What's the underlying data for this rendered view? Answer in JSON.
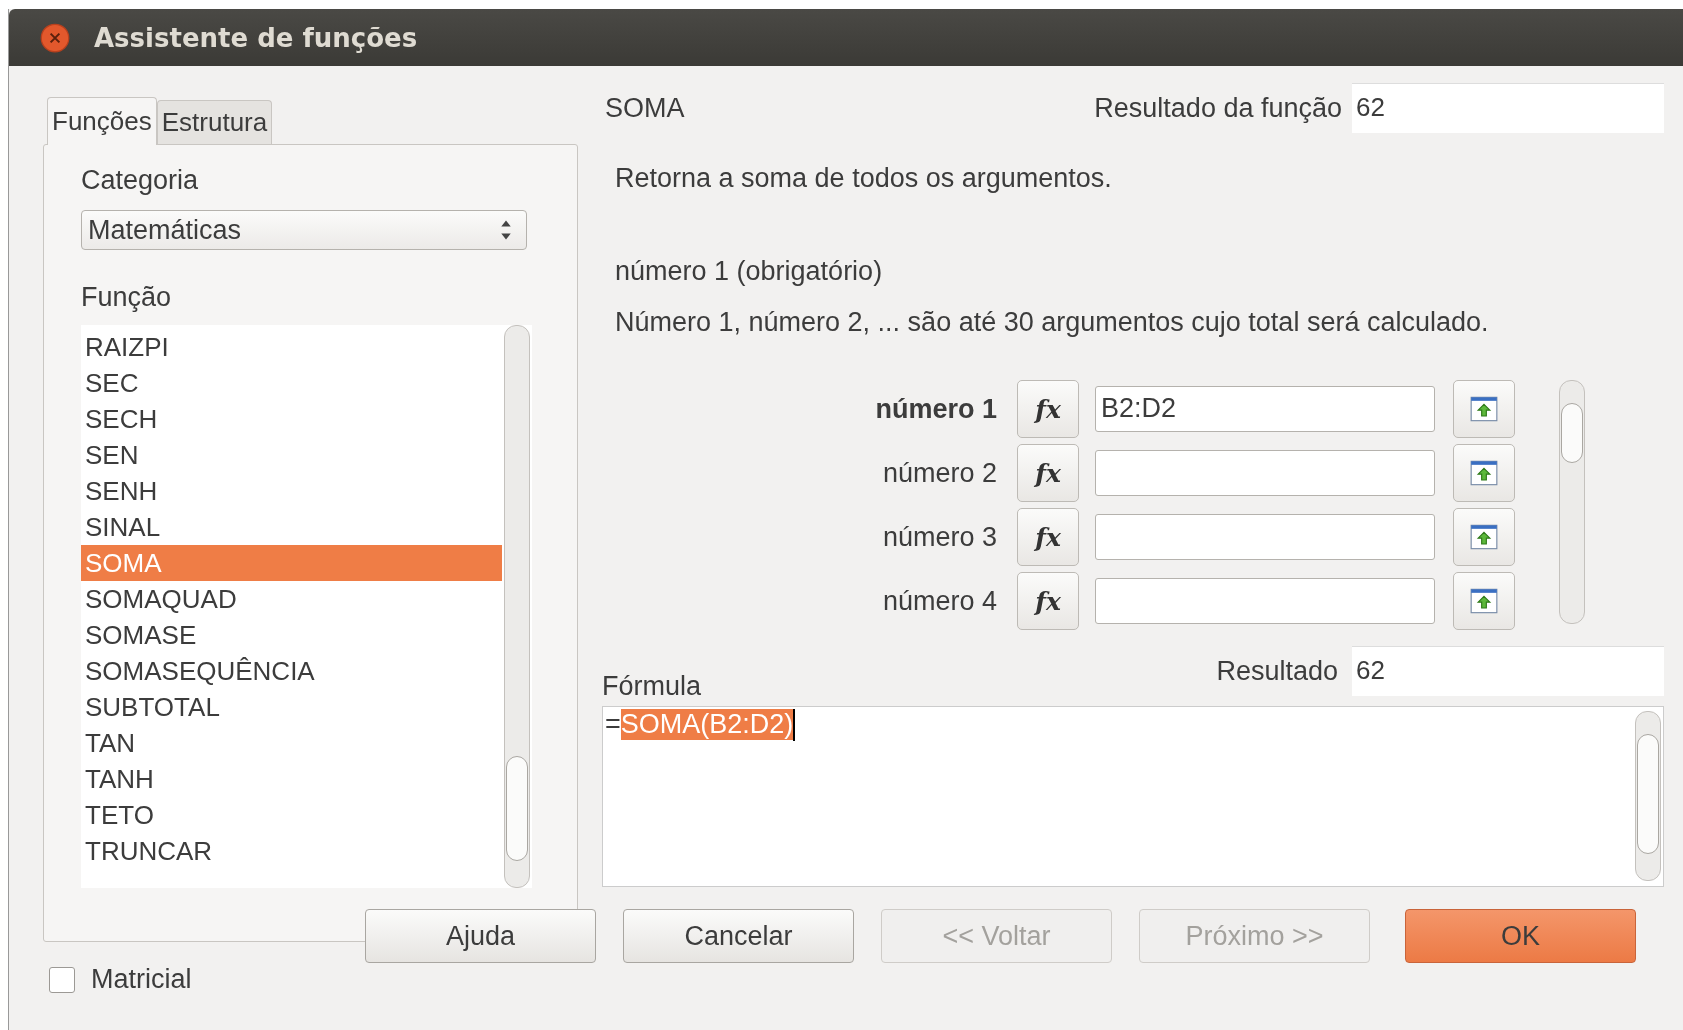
{
  "window": {
    "title": "Assistente de funções"
  },
  "tabs": [
    {
      "label": "Funções",
      "selected": true
    },
    {
      "label": "Estrutura",
      "selected": false
    }
  ],
  "category": {
    "label": "Categoria",
    "value": "Matemáticas"
  },
  "function_list": {
    "label": "Função",
    "items": [
      {
        "label": "RAIZPI",
        "selected": false
      },
      {
        "label": "SEC",
        "selected": false
      },
      {
        "label": "SECH",
        "selected": false
      },
      {
        "label": "SEN",
        "selected": false
      },
      {
        "label": "SENH",
        "selected": false
      },
      {
        "label": "SINAL",
        "selected": false
      },
      {
        "label": "SOMA",
        "selected": true
      },
      {
        "label": "SOMAQUAD",
        "selected": false
      },
      {
        "label": "SOMASE",
        "selected": false
      },
      {
        "label": "SOMASEQUÊNCIA",
        "selected": false
      },
      {
        "label": "SUBTOTAL",
        "selected": false
      },
      {
        "label": "TAN",
        "selected": false
      },
      {
        "label": "TANH",
        "selected": false
      },
      {
        "label": "TETO",
        "selected": false
      },
      {
        "label": "TRUNCAR",
        "selected": false
      }
    ]
  },
  "array_option": {
    "label": "Matricial",
    "checked": false
  },
  "function": {
    "name": "SOMA",
    "result_label": "Resultado da função",
    "result": "62",
    "description": "Retorna a soma de todos os argumentos.",
    "argument_title": "número 1 (obrigatório)",
    "argument_description": "Número 1, número 2, ... são até 30 argumentos cujo total será calculado."
  },
  "arguments": [
    {
      "label": "número 1",
      "button": "fx",
      "value": "B2:D2",
      "active": true
    },
    {
      "label": "número 2",
      "button": "fx",
      "active": false
    },
    {
      "label": "número 3",
      "button": "fx",
      "active": false
    },
    {
      "label": "número 4",
      "button": "fx",
      "active": false
    }
  ],
  "formula": {
    "label": "Fórmula",
    "prefix": "=",
    "selection": "SOMA(B2:D2)",
    "result_label": "Resultado",
    "result": "62"
  },
  "buttons": [
    {
      "label": "Ajuda",
      "kind": "normal"
    },
    {
      "label": "Cancelar",
      "kind": "normal"
    },
    {
      "label": "<< Voltar",
      "kind": "disabled"
    },
    {
      "label": "Próximo >>",
      "kind": "disabled"
    },
    {
      "label": "OK",
      "kind": "default"
    }
  ]
}
